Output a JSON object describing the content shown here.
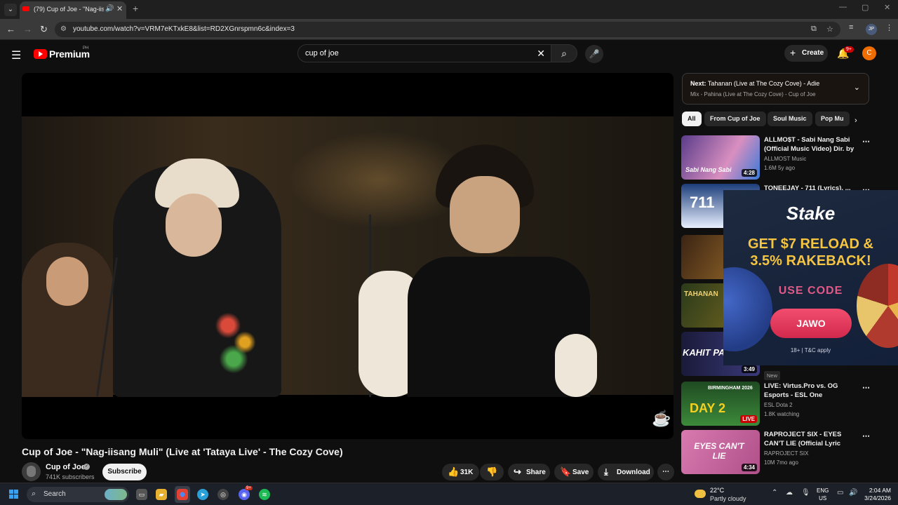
{
  "browser": {
    "tab_title": "(79) Cup of Joe - \"Nag-iisan",
    "url": "youtube.com/watch?v=VRM7eKTxkE8&list=RD2XGnrspmn6c&index=3",
    "profile": "JP"
  },
  "header": {
    "brand": "Premium",
    "country": "PH",
    "search_query": "cup of joe",
    "create_label": "Create",
    "notif_count": "9+",
    "avatar_letter": "C"
  },
  "video": {
    "title": "Cup of Joe - \"Nag-iisang Muli\" (Live at 'Tataya Live' - The Cozy Cove)",
    "channel": "Cup of Joe",
    "subscribers": "741K subscribers",
    "subscribe_label": "Subscribe",
    "likes": "31K",
    "share_label": "Share",
    "save_label": "Save",
    "download_label": "Download"
  },
  "sidebar": {
    "next_prefix": "Next:",
    "next_title": "Tahanan (Live at The Cozy Cove) - Adie",
    "next_mix": "Mix - Pahina (Live at The Cozy Cove) - Cup of Joe",
    "chips": [
      "All",
      "From Cup of Joe",
      "Soul Music",
      "Pop Mu"
    ],
    "recs": [
      {
        "title": "ALLMO$T - Sabi Nang Sabi (Official Music Video) Dir. by ...",
        "channel": "ALLMOST Music",
        "meta": "1.6M  5y ago",
        "duration": "4:28"
      },
      {
        "title": "TONEEJAY - 711 (Lyrics), ...",
        "channel": "",
        "meta": "",
        "duration": ""
      },
      {
        "title": "",
        "channel": "",
        "meta": "",
        "duration": ""
      },
      {
        "title": "",
        "channel": "",
        "meta": "",
        "duration": ""
      },
      {
        "title": "",
        "channel": "",
        "meta": "",
        "duration": "3:49"
      },
      {
        "title": "LIVE: Virtus.Pro vs. OG Esports - ESL One Birmingham 2026",
        "channel": "ESL Dota 2",
        "meta": "1.8K watching",
        "duration": "LIVE"
      },
      {
        "title": "RAPROJECT SIX - EYES CAN'T LIE (Official Lyric Visualizer)",
        "channel": "RAPROJECT SIX",
        "meta": "10M  7mo ago",
        "duration": "4:34"
      }
    ],
    "new_badge": "New",
    "rec_thumb_texts": {
      "r1": "Sabi Nang Sabi",
      "r2": "711",
      "r4": "TAHANAN",
      "r5": "KAHIT PA",
      "r6_head": "BIRMINGHAM 2026",
      "r6": "DAY 2",
      "r7": "EYES CAN'T LIE"
    }
  },
  "ad": {
    "brand": "Stake",
    "headline1": "GET $7 RELOAD &",
    "headline2": "3.5% RAKEBACK!",
    "use_code": "USE CODE",
    "code": "JAWO",
    "disclaimer": "18+ | T&C apply"
  },
  "taskbar": {
    "search_label": "Search",
    "temp": "22°C",
    "weather": "Partly cloudy",
    "lang1": "ENG",
    "lang2": "US",
    "time": "2:04 AM",
    "date": "3/24/2026",
    "discord_badge": "9+"
  },
  "colors": {
    "accent": "#ff0000",
    "bg": "#0f0f0f",
    "chip_active": "#f1f1f1"
  }
}
